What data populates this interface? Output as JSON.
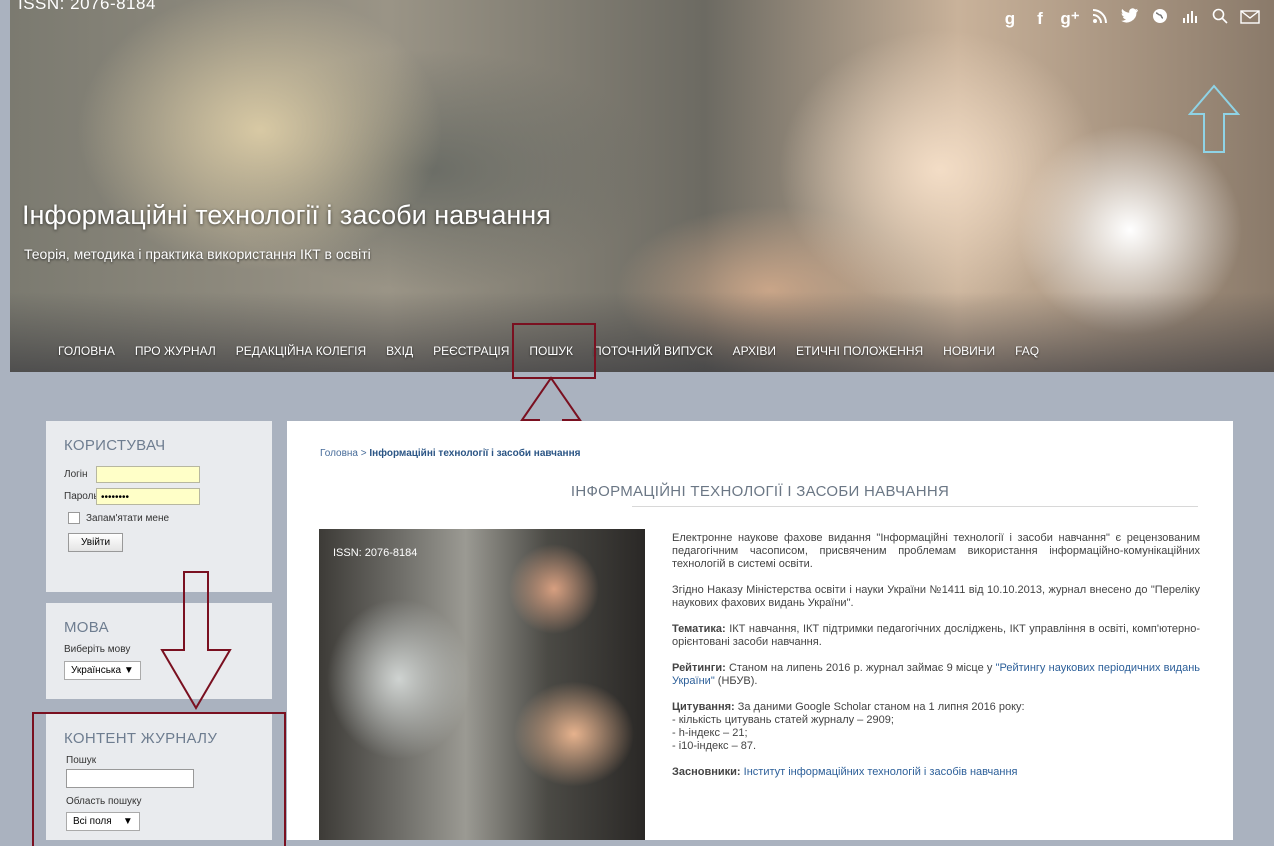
{
  "header": {
    "issn": "ISSN: 2076-8184",
    "title": "Інформаційні технології і засоби навчання",
    "subtitle": "Теорія, методика і практика використання ІКТ в освіті",
    "social_icons": [
      "google-icon",
      "facebook-icon",
      "google-plus-icon",
      "rss-icon",
      "twitter-icon",
      "globe-icon",
      "stats-icon",
      "search-icon",
      "mail-icon"
    ]
  },
  "nav": [
    "ГОЛОВНА",
    "ПРО ЖУРНАЛ",
    "РЕДАКЦІЙНА КОЛЕГІЯ",
    "ВХІД",
    "РЕЄСТРАЦІЯ",
    "ПОШУК",
    "ПОТОЧНИЙ ВИПУСК",
    "АРХІВИ",
    "ЕТИЧНІ ПОЛОЖЕННЯ",
    "НОВИНИ",
    "FAQ"
  ],
  "user_block": {
    "title": "КОРИСТУВАЧ",
    "login_label": "Логін",
    "login_value": "",
    "password_label": "Пароль",
    "password_value": "••••••••",
    "remember_label": "Запам'ятати мене",
    "submit": "Увійти"
  },
  "lang_block": {
    "title": "МОВА",
    "label": "Виберіть мову",
    "selected": "Українська"
  },
  "content_block": {
    "title": "КОНТЕНТ ЖУРНАЛУ",
    "search_label": "Пошук",
    "scope_label": "Область пошуку",
    "scope_selected": "Всі поля"
  },
  "breadcrumb": {
    "home": "Головна",
    "separator": " > ",
    "current": "Інформаційні технології і засоби навчання"
  },
  "page_title": "ІНФОРМАЦІЙНІ ТЕХНОЛОГІЇ І ЗАСОБИ НАВЧАННЯ",
  "cover_issn": "ISSN: 2076-8184",
  "content": {
    "p1": "Електронне наукове фахове видання \"Інформаційні технології і засоби навчання\" є рецензованим педагогічним часописом, присвяченим проблемам використання інформаційно-комунікаційних технологій в системі освіти.",
    "p2": "Згідно Наказу Міністерства освіти і науки України №1411 від 10.10.2013, журнал внесено до \"Переліку наукових фахових видань України\".",
    "p3_label": "Тематика:",
    "p3": " ІКТ навчання, ІКТ підтримки педагогічних досліджень, ІКТ управління в освіті, комп'ютерно-орієнтовані засоби навчання.",
    "p4_label": "Рейтинги:",
    "p4_pre": " Станом на липень 2016 р. журнал займає 9 місце у ",
    "p4_link": "\"Рейтингу наукових періодичних видань України\"",
    "p4_post": " (НБУВ).",
    "p5_label": "Цитування:",
    "p5": " За даними Google Scholar станом на 1 липня 2016 року:",
    "p5_l1": "- кількість цитувань статей журналу – 2909;",
    "p5_l2": "- h-індекс – 21;",
    "p5_l3": "- i10-індекс – 87.",
    "p6_label": "Засновники:",
    "p6_link": "Інститут інформаційних технологій і засобів навчання"
  },
  "colors": {
    "highlight": "#7a1020",
    "arrow_cyan": "#8fd3e6",
    "link": "#2c5f99"
  }
}
